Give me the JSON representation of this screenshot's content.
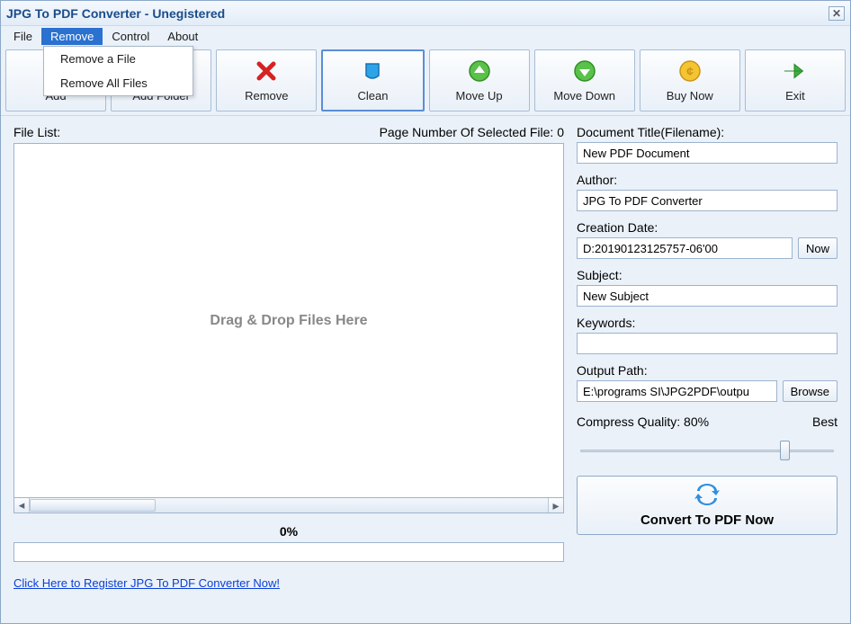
{
  "window": {
    "title": "JPG To PDF Converter - Unegistered"
  },
  "menubar": {
    "items": [
      "File",
      "Remove",
      "Control",
      "About"
    ],
    "active_index": 1
  },
  "dropdown": {
    "items": [
      "Remove a File",
      "Remove All Files"
    ]
  },
  "toolbar": {
    "add": "Add",
    "add_folder": "Add Folder",
    "remove": "Remove",
    "clean": "Clean",
    "move_up": "Move Up",
    "move_down": "Move Down",
    "buy_now": "Buy Now",
    "exit": "Exit"
  },
  "left": {
    "file_list_label": "File List:",
    "page_number_label": "Page Number Of Selected File: 0",
    "drop_hint": "Drag & Drop Files Here",
    "progress_text": "0%",
    "register_link": "Click Here to Register JPG To PDF Converter Now!"
  },
  "right": {
    "doc_title_label": "Document Title(Filename):",
    "doc_title": "New PDF Document",
    "author_label": "Author:",
    "author": "JPG To PDF Converter",
    "creation_label": "Creation Date:",
    "creation_date": "D:20190123125757-06'00",
    "now_btn": "Now",
    "subject_label": "Subject:",
    "subject": "New Subject",
    "keywords_label": "Keywords:",
    "keywords": "",
    "output_label": "Output Path:",
    "output_path": "E:\\programs SI\\JPG2PDF\\outpu",
    "browse_btn": "Browse",
    "quality_label": "Compress Quality: 80%",
    "quality_best": "Best",
    "slider_percent": 80,
    "convert_btn": "Convert To PDF Now"
  }
}
